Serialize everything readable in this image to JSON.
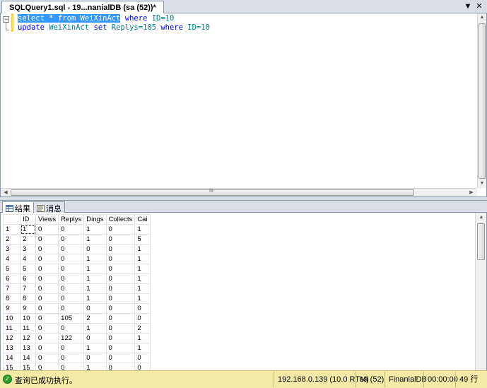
{
  "document_tab": {
    "title": "SQLQuery1.sql - 19...nanialDB (sa (52))*"
  },
  "editor": {
    "collapse_glyph": "−",
    "line1": {
      "select": "select",
      "star": "*",
      "from": "from",
      "table": "WeiXinAct",
      "where": "where",
      "cond": "ID=10"
    },
    "line2": {
      "update": "update",
      "table": "WeiXinAct",
      "set": "set",
      "assign": "Replys=105",
      "where": "where",
      "cond": "ID=10"
    },
    "hscroll_grip": "III"
  },
  "results_tabs": {
    "results": "结果",
    "messages": "消息"
  },
  "grid": {
    "columns": [
      "ID",
      "Views",
      "Replys",
      "Dings",
      "Collects",
      "Cai"
    ],
    "rows": [
      [
        "1",
        "1",
        "0",
        "0",
        "1",
        "0",
        "1"
      ],
      [
        "2",
        "2",
        "0",
        "0",
        "1",
        "0",
        "5"
      ],
      [
        "3",
        "3",
        "0",
        "0",
        "0",
        "0",
        "1"
      ],
      [
        "4",
        "4",
        "0",
        "0",
        "1",
        "0",
        "1"
      ],
      [
        "5",
        "5",
        "0",
        "0",
        "1",
        "0",
        "1"
      ],
      [
        "6",
        "6",
        "0",
        "0",
        "1",
        "0",
        "1"
      ],
      [
        "7",
        "7",
        "0",
        "0",
        "1",
        "0",
        "1"
      ],
      [
        "8",
        "8",
        "0",
        "0",
        "1",
        "0",
        "1"
      ],
      [
        "9",
        "9",
        "0",
        "0",
        "0",
        "0",
        "0"
      ],
      [
        "10",
        "10",
        "0",
        "105",
        "2",
        "0",
        "0"
      ],
      [
        "11",
        "11",
        "0",
        "0",
        "1",
        "0",
        "2"
      ],
      [
        "12",
        "12",
        "0",
        "122",
        "0",
        "0",
        "1"
      ],
      [
        "13",
        "13",
        "0",
        "0",
        "1",
        "0",
        "1"
      ],
      [
        "14",
        "14",
        "0",
        "0",
        "0",
        "0",
        "0"
      ],
      [
        "15",
        "15",
        "0",
        "0",
        "1",
        "0",
        "0"
      ]
    ]
  },
  "status": {
    "message": "查询已成功执行。",
    "server": "192.168.0.139 (10.0 RTM)",
    "user": "sa (52)",
    "database": "FinanialDB",
    "elapsed": "00:00:00",
    "rows": "49 行"
  },
  "colors": {
    "selection": "#3399ff",
    "keyword": "#0000ff",
    "identifier": "#008080",
    "statusbar": "#f5e9a8",
    "success": "#2f9e2f"
  }
}
